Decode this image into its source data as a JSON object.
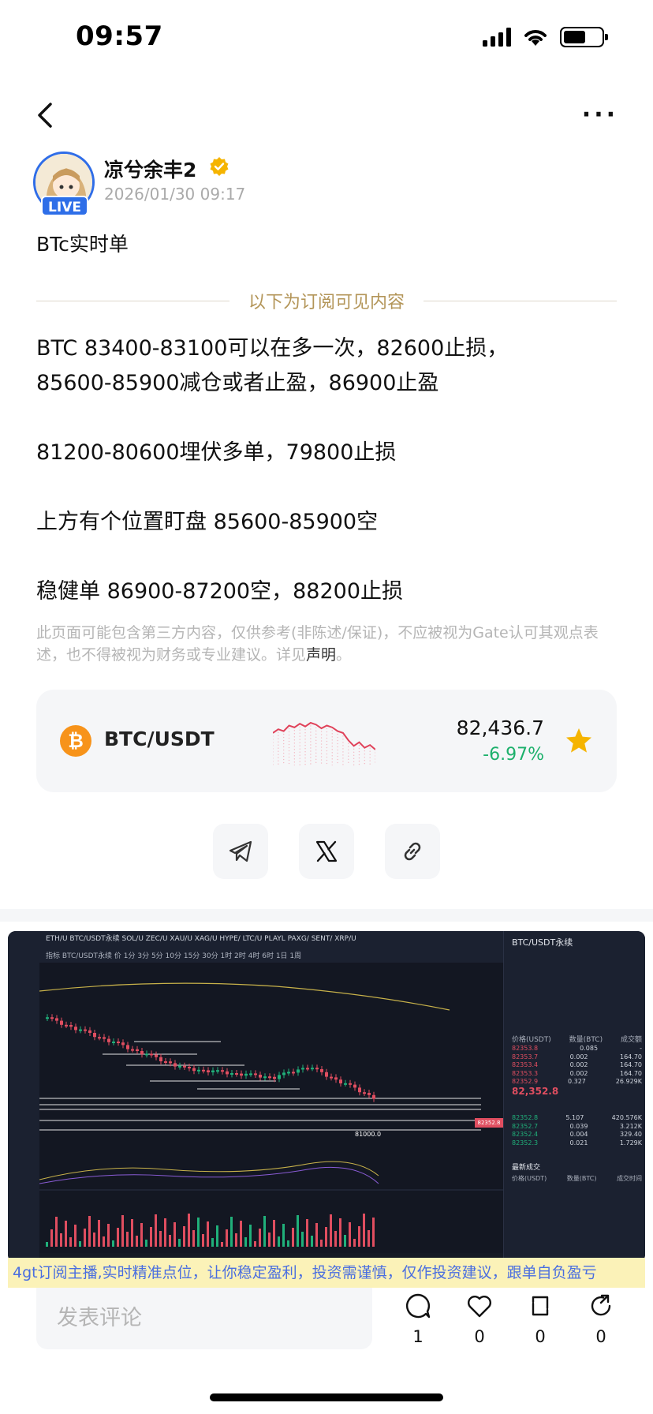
{
  "status_bar": {
    "time": "09:57"
  },
  "post": {
    "author_name": "凉兮余丰2",
    "live_badge": "LIVE",
    "timestamp": "2026/01/30 09:17",
    "title": "BTc实时单",
    "divider_text": "以下为订阅可见内容",
    "body_lines": [
      "BTC 83400-83100可以在多一次，82600止损，",
      "85600-85900减仓或者止盈，86900止盈",
      "81200-80600埋伏多单，79800止损",
      "上方有个位置盯盘 85600-85900空",
      "稳健单 86900-87200空，88200止损"
    ],
    "disclaimer_text": "此页面可能包含第三方内容，仅供参考(非陈述/保证)，不应被视为Gate认可其观点表述，也不得被视为财务或专业建议。详见",
    "disclaimer_link": "声明",
    "disclaimer_end": "。"
  },
  "ticker": {
    "pair": "BTC/USDT",
    "price": "82,436.7",
    "change": "-6.97%",
    "sparkline_values": [
      30,
      26,
      28,
      22,
      24,
      20,
      23,
      19,
      21,
      25,
      22,
      24,
      28,
      30,
      38,
      44,
      40,
      46,
      43,
      48
    ],
    "colors": {
      "down": "#e0425a",
      "change": "#1cb06b",
      "star": "#f5b400"
    }
  },
  "share": {
    "telegram_icon": "telegram-icon",
    "x_icon": "x-icon",
    "link_icon": "link-icon"
  },
  "chart_screenshot": {
    "tabs": "ETH/U  BTC/USDT永续  SOL/U  ZEC/U  XAU/U  XAG/U  HYPE/  LTC/U  PLAYL  PAXG/  SENT/  XRP/U",
    "subbar": "指标  BTC/USDT永续 价  1分  3分  5分  10分  15分  30分  1时  2时  4时  6时  1日  1周",
    "orderbook_title": "BTC/USDT永续",
    "orderbook_header": [
      "价格(USDT)",
      "数量(BTC)",
      "成交额"
    ],
    "mid_price": "82,352.8",
    "asks": [
      [
        "82353.8",
        "0.085",
        "-"
      ],
      [
        "82353.7",
        "0.002",
        "164.70"
      ],
      [
        "82353.4",
        "0.002",
        "164.70"
      ],
      [
        "82353.3",
        "0.002",
        "164.70"
      ],
      [
        "82352.9",
        "0.327",
        "26.929K"
      ]
    ],
    "bids": [
      [
        "82352.8",
        "5.107",
        "420.576K"
      ],
      [
        "82352.7",
        "0.039",
        "3.212K"
      ],
      [
        "82352.4",
        "0.004",
        "329.40"
      ],
      [
        "82352.3",
        "0.021",
        "1.729K"
      ]
    ],
    "trades_title": "最新成交",
    "trades_header": [
      "价格(USDT)",
      "数量(BTC)",
      "成交时间"
    ],
    "target_label": "81000.0",
    "price_tag": "82352.8"
  },
  "banner_text": "4gt订阅主播,实时精准点位，让你稳定盈利，投资需谨慎，仅作投资建议，跟单自负盈亏",
  "bottom_bar": {
    "comment_placeholder": "发表评论",
    "comments_count": "1",
    "likes_count": "0",
    "reposts_count": "0",
    "shares_count": "0"
  }
}
